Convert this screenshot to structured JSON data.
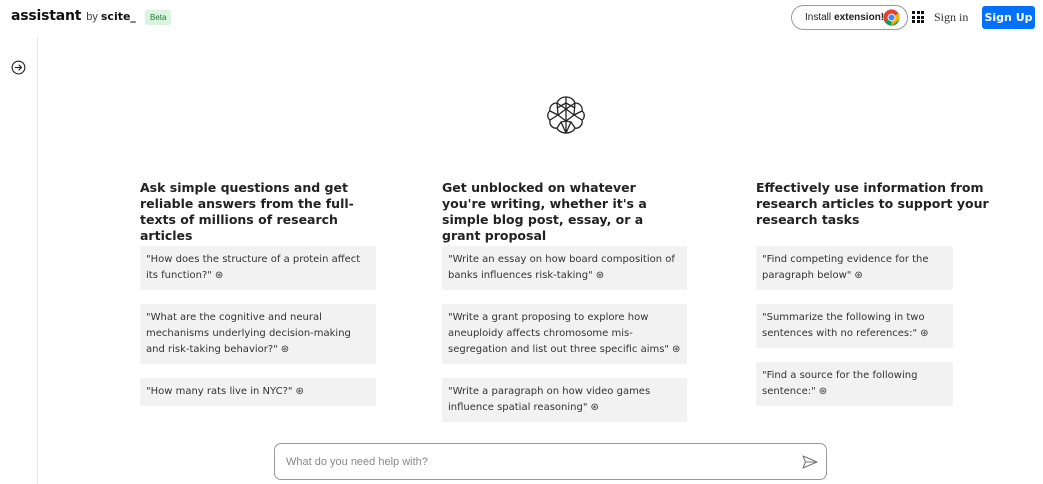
{
  "header": {
    "brand_name": "assistant",
    "brand_by": "by",
    "brand_scite": "scite_",
    "beta_badge": "Beta",
    "install_text": "Install",
    "install_bold": "extension!",
    "signin": "Sign in",
    "signup": "Sign Up",
    "signup_color": "#0070ff"
  },
  "columns": [
    {
      "title": "Ask simple questions and get reliable answers from the full-texts of millions of research articles",
      "prompts": [
        "\"How does the structure of a protein affect its function?\"",
        "\"What are the cognitive and neural mechanisms underlying decision-making and risk-taking behavior?\"",
        "\"How many rats live in NYC?\""
      ]
    },
    {
      "title": "Get unblocked on whatever you're writing, whether it's a simple blog post, essay, or a grant proposal",
      "prompts": [
        "\"Write an essay on how board composition of banks influences risk-taking\"",
        "\"Write a grant proposing to explore how aneuploidy affects chromosome mis-segregation and list out three specific aims\"",
        "\"Write a paragraph on how video games influence spatial reasoning\""
      ]
    },
    {
      "title": "Effectively use information from research articles to support your research tasks",
      "prompts": [
        "\"Find competing evidence for the paragraph below\"",
        "\"Summarize the following in two sentences with no references:\"",
        "\"Find a source for the following sentence:\""
      ]
    }
  ],
  "ask": {
    "placeholder": "What do you need help with?",
    "value": ""
  },
  "icons": {
    "sidebar_toggle": "arrow-circle-right-icon",
    "apps": "grid-apps-icon",
    "browser": "chrome-icon",
    "logo": "brain-network-icon",
    "send": "send-icon",
    "prompt_arrow": "arrow-circle-right-icon"
  }
}
